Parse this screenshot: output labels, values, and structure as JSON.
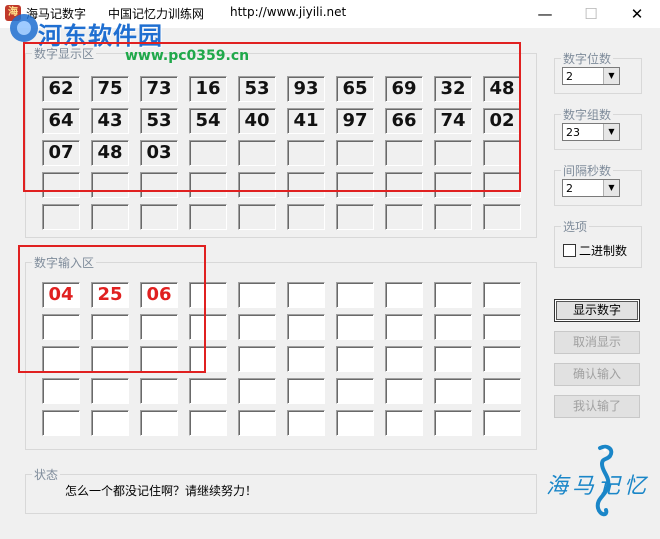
{
  "window": {
    "app_title": "海马记数字",
    "subtitle": "中国记忆力训练网",
    "url": "http://www.jiyili.net",
    "minimize": "—",
    "maximize": "☐",
    "close": "✕"
  },
  "watermark": {
    "title": "河东软件园",
    "url": "www.pc0359.cn"
  },
  "display_area": {
    "legend": "数字显示区",
    "numbers": [
      "62",
      "75",
      "73",
      "16",
      "53",
      "93",
      "65",
      "69",
      "32",
      "48",
      "64",
      "43",
      "53",
      "54",
      "40",
      "41",
      "97",
      "66",
      "74",
      "02",
      "07",
      "48",
      "03",
      "",
      "",
      "",
      "",
      "",
      "",
      "",
      "",
      "",
      "",
      "",
      "",
      "",
      "",
      "",
      "",
      "",
      "",
      "",
      "",
      "",
      "",
      "",
      "",
      "",
      "",
      ""
    ]
  },
  "input_area": {
    "legend": "数字输入区",
    "values": [
      "04",
      "25",
      "06",
      "",
      "",
      "",
      "",
      "",
      "",
      "",
      "",
      "",
      "",
      "",
      "",
      "",
      "",
      "",
      "",
      "",
      "",
      "",
      "",
      "",
      "",
      "",
      "",
      "",
      "",
      "",
      "",
      "",
      "",
      "",
      "",
      "",
      "",
      "",
      "",
      "",
      "",
      "",
      "",
      "",
      "",
      "",
      "",
      "",
      "",
      ""
    ]
  },
  "settings": {
    "digit_count": {
      "legend": "数字位数",
      "value": "2"
    },
    "group_count": {
      "legend": "数字组数",
      "value": "23"
    },
    "interval": {
      "legend": "间隔秒数",
      "value": "2"
    },
    "options": {
      "legend": "选项",
      "binary_label": "二进制数",
      "binary_checked": false
    }
  },
  "buttons": {
    "show": "显示数字",
    "cancel": "取消显示",
    "confirm": "确认输入",
    "give_up": "我认输了"
  },
  "status": {
    "legend": "状态",
    "text": "怎么一个都没记住啊？请继续努力！"
  },
  "logo": {
    "text": "海马记忆"
  },
  "colors": {
    "accent_red": "#e02020",
    "watermark_blue": "#1f6fd1",
    "watermark_green": "#1fa84a"
  }
}
